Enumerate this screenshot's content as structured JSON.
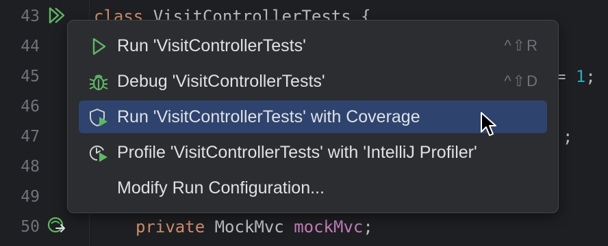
{
  "editor": {
    "line_numbers": [
      "43",
      "44",
      "45",
      "46",
      "47",
      "48",
      "49",
      "50"
    ],
    "line43": {
      "kw": "class",
      "rest": " VisitControllerTests {"
    },
    "line45_tail": {
      "eq": "= ",
      "num": "1",
      "semi": ";"
    },
    "line47_tail": ";",
    "line50": {
      "kw": "private",
      "type": " MockMvc ",
      "field": "mockMvc",
      "semi": ";"
    }
  },
  "gutter_icons": {
    "line43": "run-all-icon",
    "line50": "bean-autowire-icon"
  },
  "popup": {
    "items": [
      {
        "label": "Run 'VisitControllerTests'",
        "shortcut": "^⇧R",
        "icon": "run-icon"
      },
      {
        "label": "Debug 'VisitControllerTests'",
        "shortcut": "^⇧D",
        "icon": "debug-icon"
      },
      {
        "label": "Run 'VisitControllerTests' with Coverage",
        "shortcut": "",
        "icon": "coverage-icon",
        "selected": true
      },
      {
        "label": "Profile 'VisitControllerTests' with 'IntelliJ Profiler'",
        "shortcut": "",
        "icon": "profiler-icon"
      },
      {
        "label": "Modify Run Configuration...",
        "shortcut": ""
      }
    ]
  },
  "colors": {
    "background": "#1e1f22",
    "popup_bg": "#2b2d30",
    "selection": "#2e436e",
    "run_green": "#5fb865",
    "keyword": "#cf8e6d",
    "field": "#c77dbb",
    "number": "#2aacb8"
  }
}
